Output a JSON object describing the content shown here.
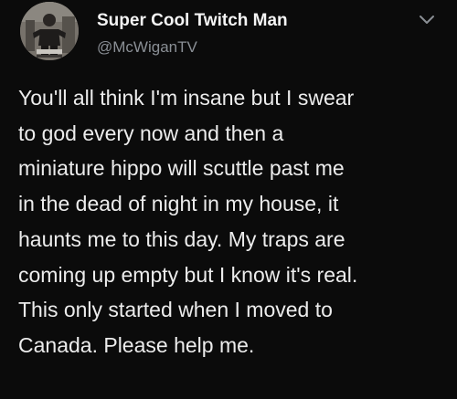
{
  "author": {
    "display_name": "Super Cool Twitch Man",
    "handle": "@McWiganTV",
    "avatar_icon": "profile-photo"
  },
  "menu": {
    "icon": "chevron-down-icon",
    "color": "#8a8f95"
  },
  "tweet": {
    "lines": [
      "You'll all think I'm insane but I swear",
      "to god every now and then a",
      "miniature hippo will scuttle past me",
      "in the dead of night in my house, it",
      "haunts me to this day. My traps are",
      "coming up empty but I know it's real.",
      "This only started when I moved to",
      "Canada. Please help me."
    ]
  },
  "colors": {
    "background": "#0b0b0b",
    "text": "#ececec",
    "secondary_text": "#8a8f95"
  }
}
